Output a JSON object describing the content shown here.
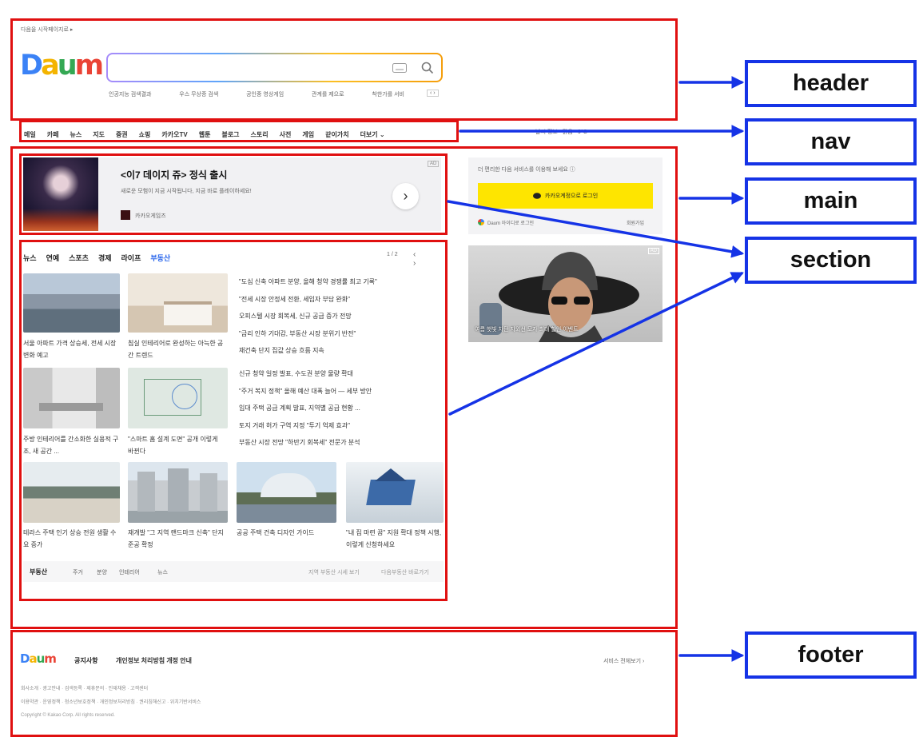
{
  "header": {
    "top_link": "다음을 시작페이지로 ▸",
    "logo": {
      "letters": [
        "D",
        "a",
        "u",
        "m"
      ],
      "colors": [
        "#3b82f6",
        "#f4b400",
        "#34a853",
        "#ea4335"
      ]
    },
    "search": {
      "placeholder": "",
      "keyboard_icon": "keyboard-icon",
      "search_icon": "search-icon"
    },
    "suggestions": [
      "인공지능 검색결과",
      "우스 무상증 검색",
      "공인중 영상게임",
      "관계를 제으로",
      "착한가를 서비"
    ],
    "suggest_pager": "‹ ›"
  },
  "nav": {
    "items": [
      "메일",
      "카페",
      "뉴스",
      "지도",
      "증권",
      "쇼핑",
      "카카오TV",
      "웹툰",
      "블로그",
      "스토리",
      "사전",
      "게임",
      "같이가치",
      "더보기 ⌄"
    ],
    "right_text": "날씨 정보 · 맑음 · 9°C"
  },
  "main": {
    "banner": {
      "title": "<이7 데이지 쥬> 정식 출시",
      "subtitle": "새로운 모험이 지금 시작됩니다, 지금 바로 플레이하세요!",
      "advertiser": "카카오게임즈",
      "ad_badge": "AD",
      "next": "›"
    },
    "login": {
      "note": "더 편리한 다음 서비스를 이용해 보세요 ⓘ",
      "button": "카카오계정으로 로그인",
      "footer_left": "Daum 아이디로 로그인",
      "footer_right": "회원가입"
    },
    "side_ad": {
      "badge": "AD",
      "caption": "여름 햇빛 차단 자외선 모자 최대 할인 이벤트"
    }
  },
  "section": {
    "tabs": [
      "뉴스",
      "연예",
      "스포츠",
      "경제",
      "라이프",
      "부동산"
    ],
    "pager": "1 / 2",
    "pager_arrows": "‹ ›",
    "row1": {
      "captions": [
        "서울 아파트 가격 상승세, 전세 시장 변화 예고",
        "침실 인테리어로 완성하는 아늑한 공간 트렌드"
      ],
      "headlines": [
        "\"도심 신축 아파트 분양, 올해 청약 경쟁률 최고 기록\"",
        "\"전세 시장 안정세 전환, 세입자 부담 완화\"",
        "오피스텔 시장 회복세, 신규 공급 증가 전망",
        "\"금리 인하 기대감, 부동산 시장 분위기 반전\"",
        "재건축 단지 집값 상승 흐름 지속"
      ]
    },
    "row2": {
      "captions": [
        "주방 인테리어를 간소화한 실용적 구조, 새 공간 ...",
        "\"스마트 홈 설계 도면\" 공개 이렇게 바뀐다"
      ],
      "headlines": [
        "신규 청약 일정 발표, 수도권 분양 물량 확대",
        "\"주거 복지 정책\" 올해 예산 대폭 늘어 — 세부 방안",
        "임대 주택 공급 계획 발표, 지역별 공급 현황 ...",
        "토지 거래 허가 구역 지정 \"투기 억제 효과\"",
        "부동산 시장 전망 \"하반기 회복세\" 전문가 분석"
      ]
    },
    "row3": {
      "captions": [
        "테라스 주택 인기 상승 전원 생활 수요 증가",
        "재개발 \"그 지역 랜드마크 신축\" 단지 준공 확정",
        "공공 주택 건축 디자인 가이드",
        "\"내 집 마련 꿈\" 지원 확대 정책 시행, 이렇게 신청하세요"
      ]
    },
    "footer_tabs": [
      "부동산",
      "주거",
      "분양",
      "인테리어",
      "뉴스"
    ],
    "footer_links": [
      "지역 부동산 시세 보기",
      "다음부동산 바로가기"
    ]
  },
  "footer": {
    "logo_letters": [
      "D",
      "a",
      "u",
      "m"
    ],
    "notice_label": "공지사항",
    "notice_text": "개인정보 처리방침 개정 안내",
    "right_link": "서비스 전체보기 ›",
    "links_row1": "회사소개 · 광고안내 · 검색등록 · 제휴문의 · 인재채용 · 고객센터",
    "links_row2": "이용약관 · 운영정책 · 청소년보호정책 · 개인정보처리방침 · 권리침해신고 · 위치기반서비스",
    "copyright": "Copyright © Kakao Corp. All rights reserved."
  },
  "annotations": {
    "labels": [
      "header",
      "nav",
      "main",
      "section",
      "footer"
    ],
    "region_color": "#e01010",
    "label_color": "#1533e6"
  }
}
